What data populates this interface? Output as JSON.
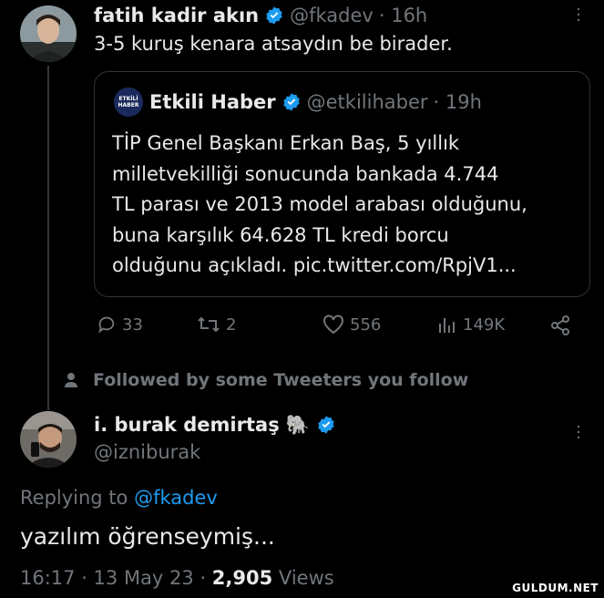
{
  "tweet1": {
    "display_name": "fatih kadir akın",
    "handle": "@fkadev",
    "time": "· 16h",
    "text": "3-5 kuruş kenara atsaydın be birader."
  },
  "quote": {
    "logo_text_line1": "ETKİLİ",
    "logo_text_line2": "HABER",
    "display_name": "Etkili Haber",
    "handle": "@etkilihaber",
    "time": "· 19h",
    "lines": [
      "TİP Genel Başkanı Erkan Baş, 5 yıllık",
      "milletvekilliği sonucunda bankada 4.744",
      "TL parası ve 2013 model arabası olduğunu,",
      "buna karşılık 64.628 TL kredi borcu",
      "olduğunu açıkladı. pic.twitter.com/RpjV1..."
    ]
  },
  "actions": {
    "replies": "33",
    "retweets": "2",
    "likes": "556",
    "views": "149K"
  },
  "social_context": "Followed by some Tweeters you follow",
  "tweet2": {
    "display_name": "i. burak demirtaş",
    "emoji": "🐘",
    "handle": "@izniburak",
    "replying_prefix": "Replying to",
    "replying_to": "@fkadev",
    "text": "yazılım öğrenseymiş...",
    "time": "16:17 · 13 May 23 ·",
    "views_count": "2,905",
    "views_label": "Views"
  },
  "watermark": "GULDUM.NET",
  "colors": {
    "accent": "#1d9bf0",
    "muted": "#71767b",
    "text": "#e7e9ea"
  }
}
